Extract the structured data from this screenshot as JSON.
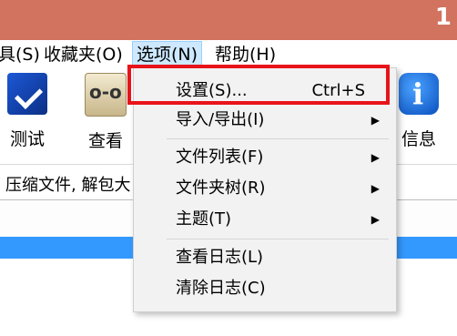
{
  "titlebar": {
    "corner_text": "1"
  },
  "menubar": {
    "items": [
      {
        "label": "具(S)"
      },
      {
        "label": "收藏夹(O)"
      },
      {
        "label": "选项(N)"
      },
      {
        "label": "帮助(H)"
      }
    ]
  },
  "toolbar": {
    "buttons": [
      {
        "label": "测试",
        "icon": "test-icon"
      },
      {
        "label": "查看",
        "icon": "view-icon"
      },
      {
        "label": "信息",
        "icon": "info-icon"
      }
    ]
  },
  "pathbar": {
    "text": "压缩文件, 解包大"
  },
  "dropdown": {
    "items": [
      {
        "label": "设置(S)...",
        "shortcut": "Ctrl+S"
      },
      {
        "label": "导入/导出(I)",
        "arrow": "▶"
      },
      {
        "label": "文件列表(F)",
        "arrow": "▶"
      },
      {
        "label": "文件夹树(R)",
        "arrow": "▶"
      },
      {
        "label": "主题(T)",
        "arrow": "▶"
      },
      {
        "label": "查看日志(L)"
      },
      {
        "label": "清除日志(C)"
      }
    ]
  },
  "colors": {
    "titlebar": "#d1735f",
    "highlight_border": "#e8131a",
    "selection": "#3399ff",
    "menu_active_bg": "#cde8ff"
  }
}
